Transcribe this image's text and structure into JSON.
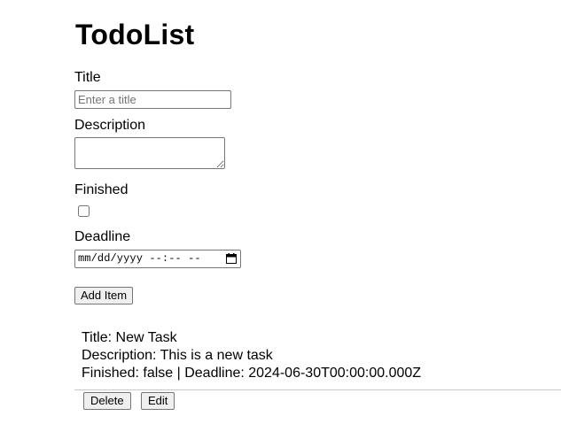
{
  "app": {
    "title": "TodoList"
  },
  "form": {
    "title_label": "Title",
    "title_placeholder": "Enter a title",
    "title_value": "",
    "description_label": "Description",
    "finished_label": "Finished",
    "finished_checked": false,
    "deadline_label": "Deadline",
    "deadline_placeholder": "mm/dd/yyyy --:-- --",
    "submit_label": "Add Item"
  },
  "todos": [
    {
      "title_line": "Title: New Task",
      "description_line": "Description: This is a new task",
      "status_line": "Finished: false | Deadline: 2024-06-30T00:00:00.000Z",
      "delete_label": "Delete",
      "edit_label": "Edit"
    }
  ],
  "icons": {
    "deadline_picker": "calendar-icon"
  }
}
